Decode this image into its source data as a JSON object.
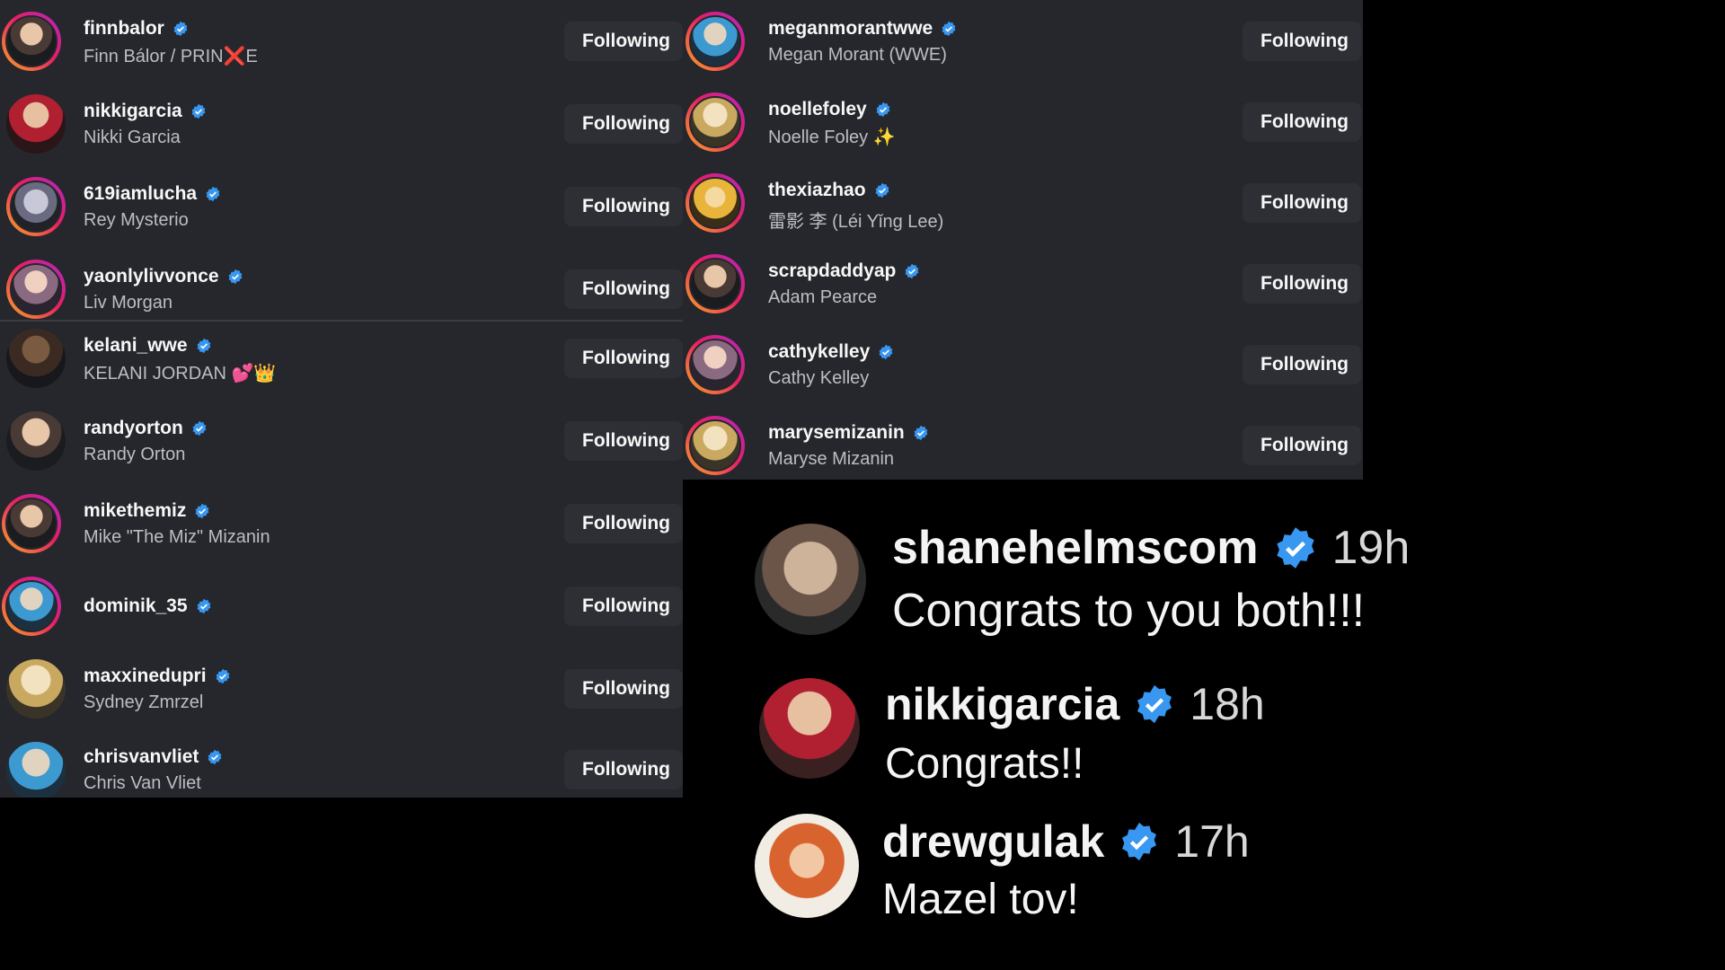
{
  "left_list": [
    {
      "handle": "finnbalor",
      "name": "Finn Bálor / PRIN❌E",
      "button": "Following"
    },
    {
      "handle": "nikkigarcia",
      "name": "Nikki Garcia",
      "button": "Following"
    },
    {
      "handle": "619iamlucha",
      "name": "Rey Mysterio",
      "button": "Following"
    },
    {
      "handle": "yaonlylivvonce",
      "name": "Liv Morgan",
      "button": "Following"
    },
    {
      "handle": "kelani_wwe",
      "name": "KELANI JORDAN 💕👑",
      "button": "Following"
    },
    {
      "handle": "randyorton",
      "name": "Randy Orton",
      "button": "Following"
    },
    {
      "handle": "mikethemiz",
      "name": "Mike \"The Miz\" Mizanin",
      "button": "Following"
    },
    {
      "handle": "dominik_35",
      "name": "",
      "button": "Following"
    },
    {
      "handle": "maxxinedupri",
      "name": "Sydney Zmrzel",
      "button": "Following"
    },
    {
      "handle": "chrisvanvliet",
      "name": "Chris Van Vliet",
      "button": "Following"
    }
  ],
  "right_list": [
    {
      "handle": "meganmorantwwe",
      "name": "Megan Morant (WWE)",
      "button": "Following"
    },
    {
      "handle": "noellefoley",
      "name": "Noelle Foley ✨",
      "button": "Following"
    },
    {
      "handle": "thexiazhao",
      "name": "雷影 李 (Léi Yǐng Lee)",
      "button": "Following"
    },
    {
      "handle": "scrapdaddyap",
      "name": "Adam Pearce",
      "button": "Following"
    },
    {
      "handle": "cathykelley",
      "name": "Cathy Kelley",
      "button": "Following"
    },
    {
      "handle": "marysemizanin",
      "name": "Maryse Mizanin",
      "button": "Following"
    }
  ],
  "comments": [
    {
      "user": "shanehelmscom",
      "time": "19h",
      "text": "Congrats to you both!!!"
    },
    {
      "user": "nikkigarcia",
      "time": "18h",
      "text": "Congrats!!"
    },
    {
      "user": "drewgulak",
      "time": "17h",
      "text": "Mazel tov!"
    }
  ],
  "colors": {
    "verified": "#3897f0",
    "panel": "#25272c",
    "button": "#2d2f34"
  }
}
